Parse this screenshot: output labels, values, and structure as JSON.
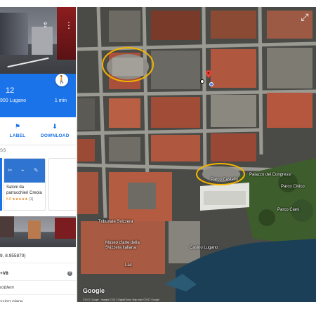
{
  "panel": {
    "share_icon": "share-icon",
    "more_icon": "more-vert-icon",
    "place_number": "12",
    "address_fragment": "900 Lugano",
    "eta": "1 min",
    "walk_icon": "walk-icon",
    "actions": [
      {
        "icon": "flag-icon",
        "label": "LABEL"
      },
      {
        "icon": "download-icon",
        "label": "DOWNLOAD"
      }
    ],
    "section_title": "SS",
    "nearby_card": {
      "name": "Saloni da parrucchieri Creola",
      "rating": "5.0",
      "stars": "★★★★★",
      "count": "(1)",
      "icons": [
        "scissors-icon",
        "hair-dryer-icon",
        "tool-icon"
      ]
    },
    "coords": "9, 8.955870)",
    "plus_code": "+V8",
    "problem_text": "roblem",
    "missing_text": "ssing place",
    "help_icon": "help-icon"
  },
  "map": {
    "labels": {
      "parco_castello": "Parco Castello",
      "palazzo_congressi": "Palazzo dei Congressi",
      "parco_civico": "Parco Civico",
      "parco_ciani": "Parco Ciani",
      "tribunale": "Tribunale Svizzera",
      "museo": "Museo d'arte della Svizzera italiana",
      "casino": "Casino Lugano",
      "lac": "Lac"
    },
    "google": "Google",
    "copyright": "©2017 Google · Images ©2017 DigitalGlobe, Map data ©2017 Google",
    "expand_icon": "expand-icon",
    "colors": {
      "annotation": "#f5b400",
      "lake": "#1b3f56",
      "park": "#3e5d2c",
      "roof": "#b5573f",
      "pin": "#ea4335",
      "blue_dot": "#4285f4"
    }
  }
}
